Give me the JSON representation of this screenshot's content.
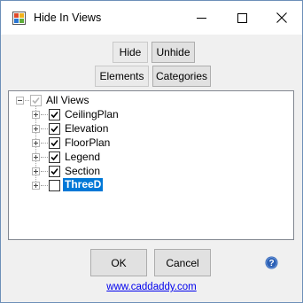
{
  "window": {
    "title": "Hide In Views",
    "icons": {
      "app": "app-icon",
      "minimize": "minimize-icon",
      "maximize": "maximize-icon",
      "close": "close-icon"
    }
  },
  "mode_buttons": {
    "hide": "Hide",
    "unhide": "Unhide"
  },
  "type_buttons": {
    "elements": "Elements",
    "categories": "Categories"
  },
  "tree": {
    "root": {
      "label": "All Views",
      "checked": true
    },
    "children": [
      {
        "label": "CeilingPlan",
        "checked": true
      },
      {
        "label": "Elevation",
        "checked": true
      },
      {
        "label": "FloorPlan",
        "checked": true
      },
      {
        "label": "Legend",
        "checked": true
      },
      {
        "label": "Section",
        "checked": true
      },
      {
        "label": "ThreeD",
        "checked": false,
        "selected": true
      }
    ]
  },
  "footer": {
    "ok": "OK",
    "cancel": "Cancel",
    "help_icon": "help-icon",
    "link": "www.caddaddy.com"
  },
  "colors": {
    "selection": "#0078d7",
    "link": "#0000ee",
    "help": "#2b5fb4"
  }
}
